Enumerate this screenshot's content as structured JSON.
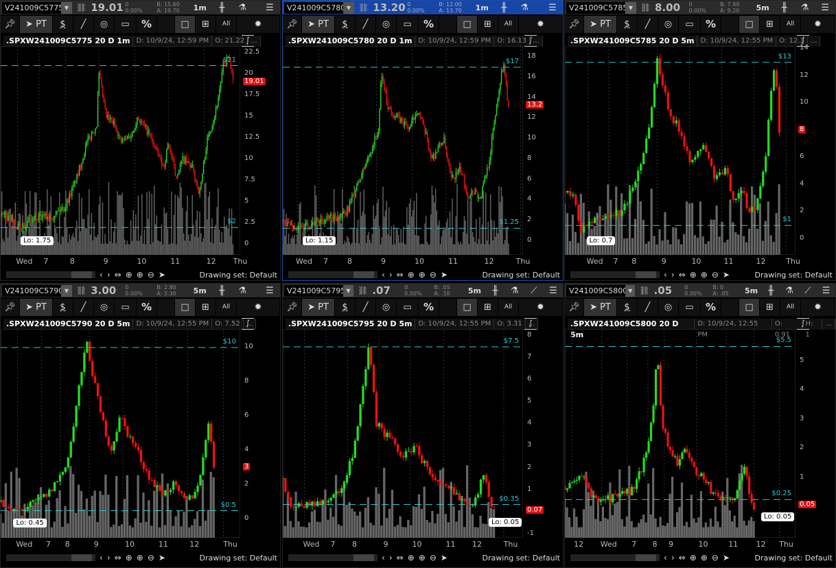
{
  "toolbar": {
    "pt": "PT",
    "dollar": "$",
    "percent": "%",
    "all": "All"
  },
  "panels": [
    {
      "symbol": "V241009C5775",
      "last": "19.01",
      "chg": "0",
      "chg_pct": "0.00%",
      "bid": "B: 15.60",
      "ask": "A: 19.70",
      "tf": "1m",
      "active": false,
      "drawing_icon": false,
      "title": ".SPXW241009C5775 20 D 1m",
      "date": "D: 10/9/24, 12:59 PM",
      "open": "O: 21.22",
      "extra": "...",
      "y_range": [
        -1.2,
        23.3
      ],
      "y_ticks": [
        "22.5",
        "20",
        "17.5",
        "15",
        "12.5",
        "10",
        "7.5",
        "5",
        "2.5",
        "0"
      ],
      "price_tag": "19.01",
      "price": 19.01,
      "hi_label": "$21",
      "hi": 21,
      "lo_label": "$2",
      "lo": 2,
      "low_label": "Lo: 1.75",
      "low": 1.75,
      "low_t": 0.6,
      "candles": 190,
      "x_ticks": [
        [
          "Wed",
          0.7
        ],
        [
          "7",
          1.6
        ],
        [
          "8",
          2.7
        ],
        [
          "9",
          4.1
        ],
        [
          "10",
          5.6
        ],
        [
          "11",
          7.0
        ],
        [
          "12",
          8.5
        ],
        [
          "Thu",
          10
        ]
      ],
      "anchors": [
        [
          0,
          3.5
        ],
        [
          0.5,
          3
        ],
        [
          0.6,
          1.75
        ],
        [
          1.2,
          2.8
        ],
        [
          2.2,
          3.5
        ],
        [
          2.7,
          4.5
        ],
        [
          3.2,
          8
        ],
        [
          3.6,
          12
        ],
        [
          4.0,
          14
        ],
        [
          4.1,
          20
        ],
        [
          4.4,
          15
        ],
        [
          4.8,
          14
        ],
        [
          5.0,
          12
        ],
        [
          5.5,
          13
        ],
        [
          5.7,
          15
        ],
        [
          6.2,
          13
        ],
        [
          6.5,
          11
        ],
        [
          6.8,
          9
        ],
        [
          7.0,
          12
        ],
        [
          7.3,
          8
        ],
        [
          7.6,
          10
        ],
        [
          8.0,
          9
        ],
        [
          8.3,
          6
        ],
        [
          8.6,
          12
        ],
        [
          9.0,
          16
        ],
        [
          9.3,
          21
        ],
        [
          9.5,
          22
        ],
        [
          9.7,
          19
        ]
      ],
      "drawing_set": "Drawing set: Default"
    },
    {
      "symbol": "V241009C5780",
      "last": "13.20",
      "chg": "0",
      "chg_pct": "0.00%",
      "bid": "B: 12.00",
      "ask": "A: 13.70",
      "tf": "1m",
      "active": true,
      "drawing_icon": false,
      "title": ".SPXW241009C5780 20 D 1m",
      "date": "D: 10/9/24, 12:59 PM",
      "open": "O: 16.13",
      "extra": "...",
      "y_range": [
        -1.34,
        19.07
      ],
      "y_ticks": [
        "18",
        "16",
        "14",
        "12",
        "10",
        "8",
        "6",
        "4",
        "2",
        "0"
      ],
      "price_tag": "13.2",
      "price": 13.2,
      "hi_label": "$17",
      "hi": 17,
      "lo_label": "$1.25",
      "lo": 1.25,
      "low_label": "Lo: 1.15",
      "low": 1.15,
      "low_t": 0.6,
      "candles": 190,
      "x_ticks": [
        [
          "Wed",
          0.6
        ],
        [
          "7",
          1.5
        ],
        [
          "8",
          2.5
        ],
        [
          "9",
          3.9
        ],
        [
          "10",
          5.4
        ],
        [
          "11",
          6.8
        ],
        [
          "12",
          8.3
        ],
        [
          "Thu",
          9.9
        ]
      ],
      "anchors": [
        [
          0,
          2
        ],
        [
          0.4,
          1.5
        ],
        [
          0.6,
          1.15
        ],
        [
          1.5,
          2
        ],
        [
          2.6,
          2.5
        ],
        [
          3.2,
          6
        ],
        [
          3.7,
          9
        ],
        [
          4.0,
          11
        ],
        [
          4.1,
          16.5
        ],
        [
          4.4,
          13
        ],
        [
          4.8,
          12
        ],
        [
          5.3,
          11
        ],
        [
          5.6,
          13
        ],
        [
          6,
          10
        ],
        [
          6.2,
          8
        ],
        [
          6.7,
          10
        ],
        [
          7.0,
          6
        ],
        [
          7.4,
          7
        ],
        [
          7.7,
          4.5
        ],
        [
          8.0,
          5
        ],
        [
          8.2,
          4
        ],
        [
          8.6,
          8
        ],
        [
          9.0,
          15
        ],
        [
          9.2,
          17.5
        ],
        [
          9.4,
          13
        ]
      ],
      "drawing_set": "Drawing set: Default"
    },
    {
      "symbol": "V241009C5785",
      "last": "8.00",
      "chg": "0",
      "chg_pct": "0.00%",
      "bid": "B: 7.90",
      "ask": "A: 9.20",
      "tf": "5m",
      "active": false,
      "drawing_icon": false,
      "title": ".SPXW241009C5785 20 D 5m",
      "date": "D: 10/9/24, 12:55 PM",
      "open": "O: 12.3",
      "extra": "...",
      "y_range": [
        -1.16,
        14.2
      ],
      "y_ticks": [
        "14",
        "12",
        "10",
        "8",
        "6",
        "4",
        "2",
        "0"
      ],
      "price_tag": "8",
      "price": 8,
      "hi_label": "$13",
      "hi": 13,
      "lo_label": "$1",
      "lo": 1,
      "low_label": "Lo: 0.7",
      "low": 0.7,
      "low_t": 0.7,
      "candles": 80,
      "x_ticks": [
        [
          "Wed",
          1.0
        ],
        [
          "7",
          1.9
        ],
        [
          "8",
          2.7
        ],
        [
          "9",
          4.0
        ],
        [
          "10",
          5.4
        ],
        [
          "11",
          6.8
        ],
        [
          "12",
          8.2
        ],
        [
          "Thu",
          9.6
        ]
      ],
      "anchors": [
        [
          0,
          3.5
        ],
        [
          0.4,
          3
        ],
        [
          0.7,
          0.7
        ],
        [
          1.5,
          1.5
        ],
        [
          2.5,
          2
        ],
        [
          3.0,
          4
        ],
        [
          3.5,
          7
        ],
        [
          3.8,
          10
        ],
        [
          4.0,
          13.2
        ],
        [
          4.3,
          11
        ],
        [
          4.6,
          9
        ],
        [
          5.0,
          8
        ],
        [
          5.5,
          5.5
        ],
        [
          6,
          7
        ],
        [
          6.5,
          4.5
        ],
        [
          7,
          5
        ],
        [
          7.3,
          3
        ],
        [
          7.7,
          3.5
        ],
        [
          8,
          2
        ],
        [
          8.3,
          2.5
        ],
        [
          8.7,
          6
        ],
        [
          8.9,
          10
        ],
        [
          9.1,
          13
        ],
        [
          9.3,
          8
        ]
      ],
      "drawing_set": "Drawing set: Default"
    },
    {
      "symbol": "V241009C5790",
      "last": "3.00",
      "chg": "0",
      "chg_pct": "0.00%",
      "bid": "B: 2.80",
      "ask": "A: 3.30",
      "tf": "5m",
      "active": false,
      "drawing_icon": false,
      "title": ".SPXW241009C5790 20 D 5m",
      "date": "D: 10/9/24, 12:55 PM",
      "open": "O: 7.52",
      "extra": "...",
      "y_range": [
        -1.08,
        11.08
      ],
      "y_ticks": [
        "10",
        "8",
        "6",
        "4",
        "2",
        "0"
      ],
      "price_tag": "3",
      "price": 3,
      "hi_label": "$10",
      "hi": 10,
      "lo_label": "$0.5",
      "lo": 0.5,
      "low_label": "Lo: 0.45",
      "low": 0.45,
      "low_t": 0.3,
      "candles": 80,
      "x_ticks": [
        [
          "Wed",
          0.7
        ],
        [
          "7",
          1.7
        ],
        [
          "8",
          2.5
        ],
        [
          "9",
          3.7
        ],
        [
          "10",
          5.1
        ],
        [
          "11",
          6.5
        ],
        [
          "12",
          7.8
        ],
        [
          "Thu",
          9.3
        ]
      ],
      "anchors": [
        [
          0,
          1
        ],
        [
          0.3,
          0.45
        ],
        [
          1,
          0.6
        ],
        [
          2,
          1.5
        ],
        [
          2.7,
          3
        ],
        [
          3.0,
          5
        ],
        [
          3.3,
          8
        ],
        [
          3.6,
          10.3
        ],
        [
          3.9,
          8
        ],
        [
          4.2,
          6
        ],
        [
          4.6,
          4
        ],
        [
          5.0,
          6
        ],
        [
          5.3,
          5
        ],
        [
          5.7,
          4
        ],
        [
          6,
          3
        ],
        [
          6.4,
          2
        ],
        [
          6.8,
          1.5
        ],
        [
          7.2,
          2
        ],
        [
          7.7,
          1
        ],
        [
          8.1,
          1.5
        ],
        [
          8.4,
          3
        ],
        [
          8.7,
          6
        ],
        [
          8.9,
          3
        ]
      ],
      "drawing_set": "Drawing set: Default"
    },
    {
      "symbol": "V241009C5795",
      "last": ".07",
      "chg": "0",
      "chg_pct": "0.00%",
      "bid": "B: .05",
      "ask": "A: .10",
      "tf": "5m",
      "active": false,
      "drawing_icon": true,
      "title": ".SPXW241009C5795 20 D 5m",
      "date": "D: 10/9/24, 12:55 PM",
      "open": "O: 3.31",
      "extra": "...",
      "y_range": [
        -1.16,
        8.31
      ],
      "y_ticks": [
        "8",
        "7",
        "6",
        "5",
        "4",
        "3",
        "2",
        "1",
        "0",
        "-1"
      ],
      "price_tag": "0.07",
      "price": 0.07,
      "hi_label": "$7.5",
      "hi": 7.5,
      "lo_label": "$0.35",
      "lo": 0.35,
      "low_label": "Lo: 0.05",
      "low": 0.05,
      "low_t": 8.8,
      "candles": 80,
      "x_ticks": [
        [
          "Wed",
          0.9
        ],
        [
          "7",
          1.8
        ],
        [
          "8",
          2.7
        ],
        [
          "9",
          4.0
        ],
        [
          "10",
          5.3
        ],
        [
          "11",
          6.7
        ],
        [
          "12",
          7.8
        ],
        [
          "Thu",
          9.2
        ]
      ],
      "anchors": [
        [
          0,
          1.5
        ],
        [
          0.3,
          0.3
        ],
        [
          1.5,
          0.4
        ],
        [
          2.5,
          1
        ],
        [
          3.0,
          3
        ],
        [
          3.4,
          6
        ],
        [
          3.6,
          7.6
        ],
        [
          3.9,
          4
        ],
        [
          4.3,
          3.5
        ],
        [
          4.7,
          3
        ],
        [
          5,
          2.5
        ],
        [
          5.5,
          3
        ],
        [
          6,
          2
        ],
        [
          6.5,
          1.2
        ],
        [
          7,
          1
        ],
        [
          7.5,
          0.6
        ],
        [
          8,
          0.4
        ],
        [
          8.4,
          2
        ],
        [
          8.6,
          0.5
        ],
        [
          8.8,
          0.07
        ]
      ],
      "drawing_set": "Drawing set: Default"
    },
    {
      "symbol": "V241009C5800",
      "last": ".05",
      "chg": "0",
      "chg_pct": "0.00%",
      "bid": "B: 0",
      "ask": "A: .05",
      "tf": "5m",
      "active": false,
      "drawing_icon": true,
      "title": ".SPXW241009C5800 20 D 5m",
      "date": "D: 10/9/24, 12:55 PM",
      "open": "O: 0.91",
      "extra": "H: 1",
      "extra2": "...",
      "y_range": [
        -1.06,
        6.1
      ],
      "y_ticks": [
        "5",
        "4",
        "3",
        "2",
        "1",
        "0"
      ],
      "price_tag": "0.05",
      "price": 0.05,
      "hi_label": "$5.5",
      "hi": 5.5,
      "lo_label": "$0.25",
      "lo": 0.25,
      "low_label": "Lo: 0.05",
      "low": 0.05,
      "low_t": 8.5,
      "candles": 80,
      "x_ticks": [
        [
          "12",
          0.3
        ],
        [
          "Wed",
          1.6
        ],
        [
          "7",
          2.7
        ],
        [
          "8",
          3.6
        ],
        [
          "9",
          4.3
        ],
        [
          "10",
          5.7
        ],
        [
          "11",
          7.0
        ],
        [
          "12",
          8.2
        ],
        [
          "Thu",
          9.3
        ]
      ],
      "anchors": [
        [
          0,
          0.7
        ],
        [
          0.8,
          1
        ],
        [
          1.2,
          0.3
        ],
        [
          2,
          0.3
        ],
        [
          3,
          0.6
        ],
        [
          3.4,
          1.5
        ],
        [
          3.8,
          3
        ],
        [
          4.0,
          5.4
        ],
        [
          4.2,
          3
        ],
        [
          4.5,
          2
        ],
        [
          4.9,
          1.5
        ],
        [
          5.3,
          2
        ],
        [
          5.6,
          1.3
        ],
        [
          6,
          1
        ],
        [
          6.4,
          0.5
        ],
        [
          6.8,
          0.3
        ],
        [
          7.4,
          0.3
        ],
        [
          7.8,
          1.4
        ],
        [
          8.0,
          0.5
        ],
        [
          8.2,
          0.05
        ]
      ],
      "drawing_set": "Drawing set: Default"
    }
  ]
}
